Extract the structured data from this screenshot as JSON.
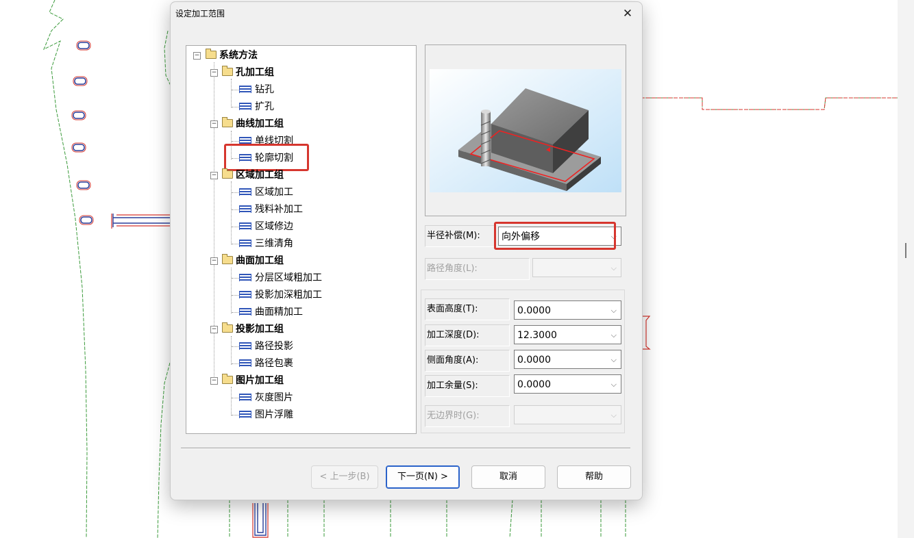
{
  "dialog": {
    "title": "设定加工范围",
    "close_glyph": "✕"
  },
  "tree": {
    "root": "系统方法",
    "groups": [
      {
        "label": "孔加工组",
        "items": [
          "钻孔",
          "扩孔"
        ]
      },
      {
        "label": "曲线加工组",
        "items": [
          "单线切割",
          "轮廓切割"
        ]
      },
      {
        "label": "区域加工组",
        "items": [
          "区域加工",
          "残料补加工",
          "区域修边",
          "三维清角"
        ]
      },
      {
        "label": "曲面加工组",
        "items": [
          "分层区域粗加工",
          "投影加深粗加工",
          "曲面精加工"
        ]
      },
      {
        "label": "投影加工组",
        "items": [
          "路径投影",
          "路径包裹"
        ]
      },
      {
        "label": "图片加工组",
        "items": [
          "灰度图片",
          "图片浮雕"
        ]
      }
    ],
    "highlighted_item": "轮廓切割",
    "highlight_color": "#d6362e"
  },
  "params": {
    "radius_comp": {
      "label": "半径补偿(M):",
      "value": "向外偏移"
    },
    "path_angle": {
      "label": "路径角度(L):",
      "value": ""
    },
    "surface_height": {
      "label": "表面高度(T):",
      "value": "0.0000"
    },
    "depth": {
      "label": "加工深度(D):",
      "value": "12.3000"
    },
    "side_angle": {
      "label": "侧面角度(A):",
      "value": "0.0000"
    },
    "allowance": {
      "label": "加工余量(S):",
      "value": "0.0000"
    },
    "no_boundary": {
      "label": "无边界时(G):",
      "value": ""
    }
  },
  "buttons": {
    "prev": "< 上一步(B)",
    "next": "下一页(N) >",
    "cancel": "取消",
    "help": "帮助"
  },
  "icons": {
    "folder": "folder-icon",
    "leaf": "toolpath-icon",
    "toggle": "collapse-toggle-icon",
    "dropdown": "chevron-down-icon"
  }
}
